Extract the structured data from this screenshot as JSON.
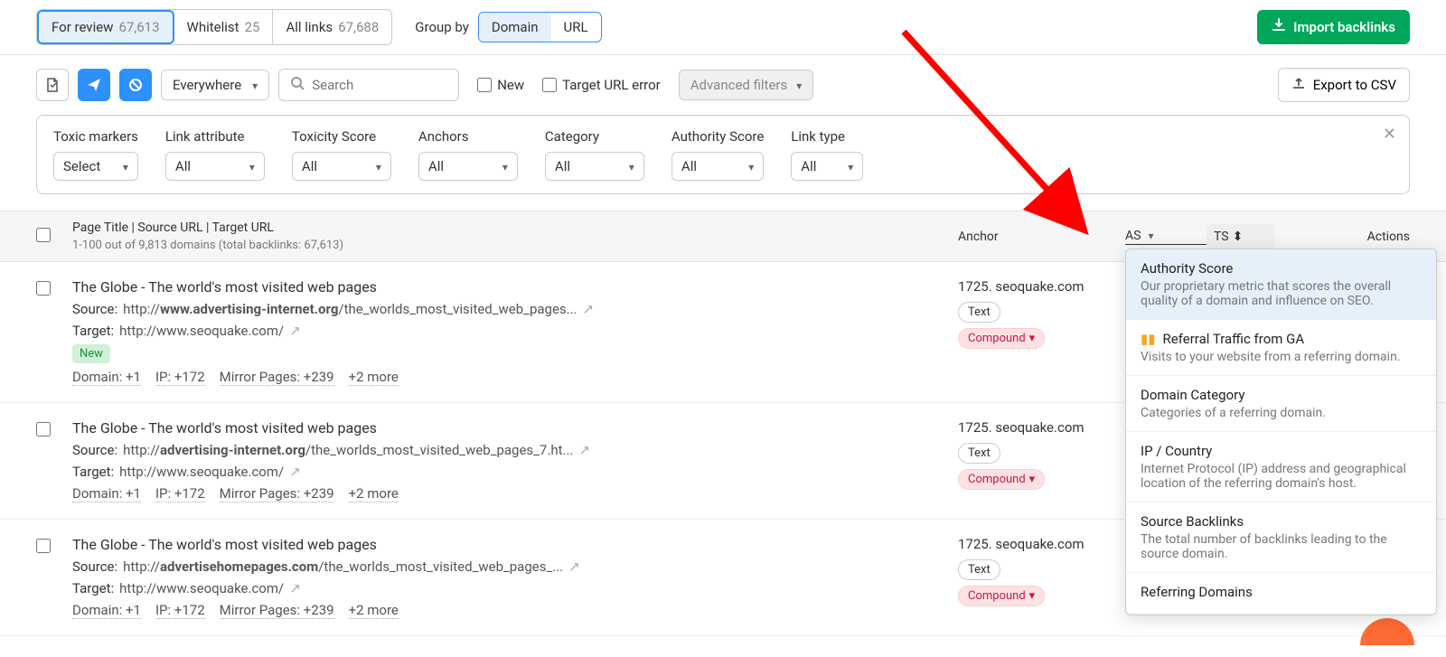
{
  "tabs": {
    "for_review": {
      "label": "For review",
      "count": "67,613"
    },
    "whitelist": {
      "label": "Whitelist",
      "count": "25"
    },
    "all_links": {
      "label": "All links",
      "count": "67,688"
    }
  },
  "group_by": {
    "label": "Group by",
    "opt1": "Domain",
    "opt2": "URL"
  },
  "import_label": "Import backlinks",
  "scope_dropdown": "Everywhere",
  "search_placeholder": "Search",
  "opt_new": "New",
  "opt_target_err": "Target URL error",
  "adv_filters": "Advanced filters",
  "export_label": "Export to CSV",
  "filters": {
    "toxic": {
      "label": "Toxic markers",
      "value": "Select"
    },
    "linkattr": {
      "label": "Link attribute",
      "value": "All"
    },
    "toxscore": {
      "label": "Toxicity Score",
      "value": "All"
    },
    "anchors": {
      "label": "Anchors",
      "value": "All"
    },
    "category": {
      "label": "Category",
      "value": "All"
    },
    "authscore": {
      "label": "Authority Score",
      "value": "All"
    },
    "linktype": {
      "label": "Link type",
      "value": "All"
    }
  },
  "thead": {
    "page": "Page Title | Source URL | Target URL",
    "sub": "1-100 out of 9,813 domains (total backlinks: 67,613)",
    "anchor": "Anchor",
    "as": "AS",
    "ts": "TS",
    "actions": "Actions"
  },
  "rows": [
    {
      "title": "The Globe - The world's most visited web pages",
      "source_pre": "http://",
      "source_bold": "www.advertising-internet.org",
      "source_rest": "/the_worlds_most_visited_web_pages...",
      "target": "http://www.seoquake.com/",
      "new_badge": "New",
      "domain": "Domain: +1",
      "ip": "IP: +172",
      "mirror": "Mirror Pages: +239",
      "more": "+2 more",
      "anchor": "1725. seoquake.com",
      "pill1": "Text",
      "pill2": "Compound"
    },
    {
      "title": "The Globe - The world's most visited web pages",
      "source_pre": "http://",
      "source_bold": "advertising-internet.org",
      "source_rest": "/the_worlds_most_visited_web_pages_7.ht...",
      "target": "http://www.seoquake.com/",
      "new_badge": "",
      "domain": "Domain: +1",
      "ip": "IP: +172",
      "mirror": "Mirror Pages: +239",
      "more": "+2 more",
      "anchor": "1725. seoquake.com",
      "pill1": "Text",
      "pill2": "Compound"
    },
    {
      "title": "The Globe - The world's most visited web pages",
      "source_pre": "http://",
      "source_bold": "advertisehomepages.com",
      "source_rest": "/the_worlds_most_visited_web_pages_...",
      "target": "http://www.seoquake.com/",
      "new_badge": "",
      "domain": "Domain: +1",
      "ip": "IP: +172",
      "mirror": "Mirror Pages: +239",
      "more": "+2 more",
      "anchor": "1725. seoquake.com",
      "pill1": "Text",
      "pill2": "Compound"
    }
  ],
  "popover": [
    {
      "title": "Authority Score",
      "sub": "Our proprietary metric that scores the overall quality of a domain and influence on SEO.",
      "sel": true
    },
    {
      "title": "Referral Traffic from GA",
      "sub": "Visits to your website from a referring domain.",
      "ga": true
    },
    {
      "title": "Domain Category",
      "sub": "Categories of a referring domain."
    },
    {
      "title": "IP / Country",
      "sub": "Internet Protocol (IP) address and geographical location of the referring domain's host."
    },
    {
      "title": "Source Backlinks",
      "sub": "The total number of backlinks leading to the source domain."
    },
    {
      "title": "Referring Domains",
      "sub": ""
    }
  ],
  "labels": {
    "source": "Source:",
    "target": "Target:"
  }
}
